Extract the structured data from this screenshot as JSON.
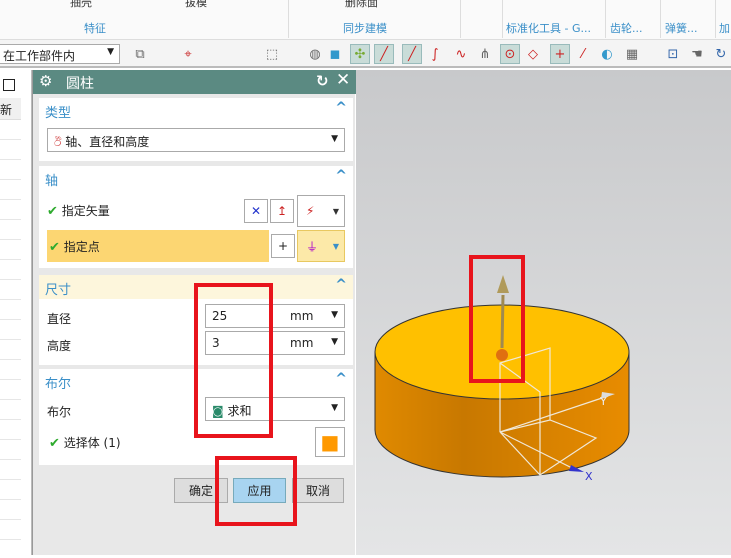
{
  "ribbon": {
    "top_items": [
      "抽壳",
      "拔模",
      "删除面"
    ],
    "groups": [
      "特征",
      "同步建模",
      "标准化工具 - G...",
      "齿轮...",
      "弹簧...",
      "加"
    ]
  },
  "toolbar": {
    "selection_scope": "在工作部件内"
  },
  "left_panel": {
    "header": "新"
  },
  "dialog": {
    "title": "圆柱",
    "type_section": {
      "header": "类型",
      "selected": "轴、直径和高度"
    },
    "axis_section": {
      "header": "轴",
      "specify_vector": "指定矢量",
      "specify_point": "指定点"
    },
    "dimensions_section": {
      "header": "尺寸",
      "diameter_label": "直径",
      "diameter_value": "25",
      "diameter_unit": "mm",
      "height_label": "高度",
      "height_value": "3",
      "height_unit": "mm"
    },
    "boolean_section": {
      "header": "布尔",
      "boolean_label": "布尔",
      "boolean_value": "求和",
      "select_body": "选择体 (1)"
    },
    "buttons": {
      "ok": "确定",
      "apply": "应用",
      "cancel": "取消"
    }
  },
  "viewport": {
    "axis_y": "Y",
    "axis_x": "X"
  },
  "colors": {
    "accent": "#3a8fc8",
    "title_bar": "#5b8a82",
    "highlight": "#fcd672",
    "annotation": "#e8141c",
    "cylinder_top": "#ffc000"
  }
}
